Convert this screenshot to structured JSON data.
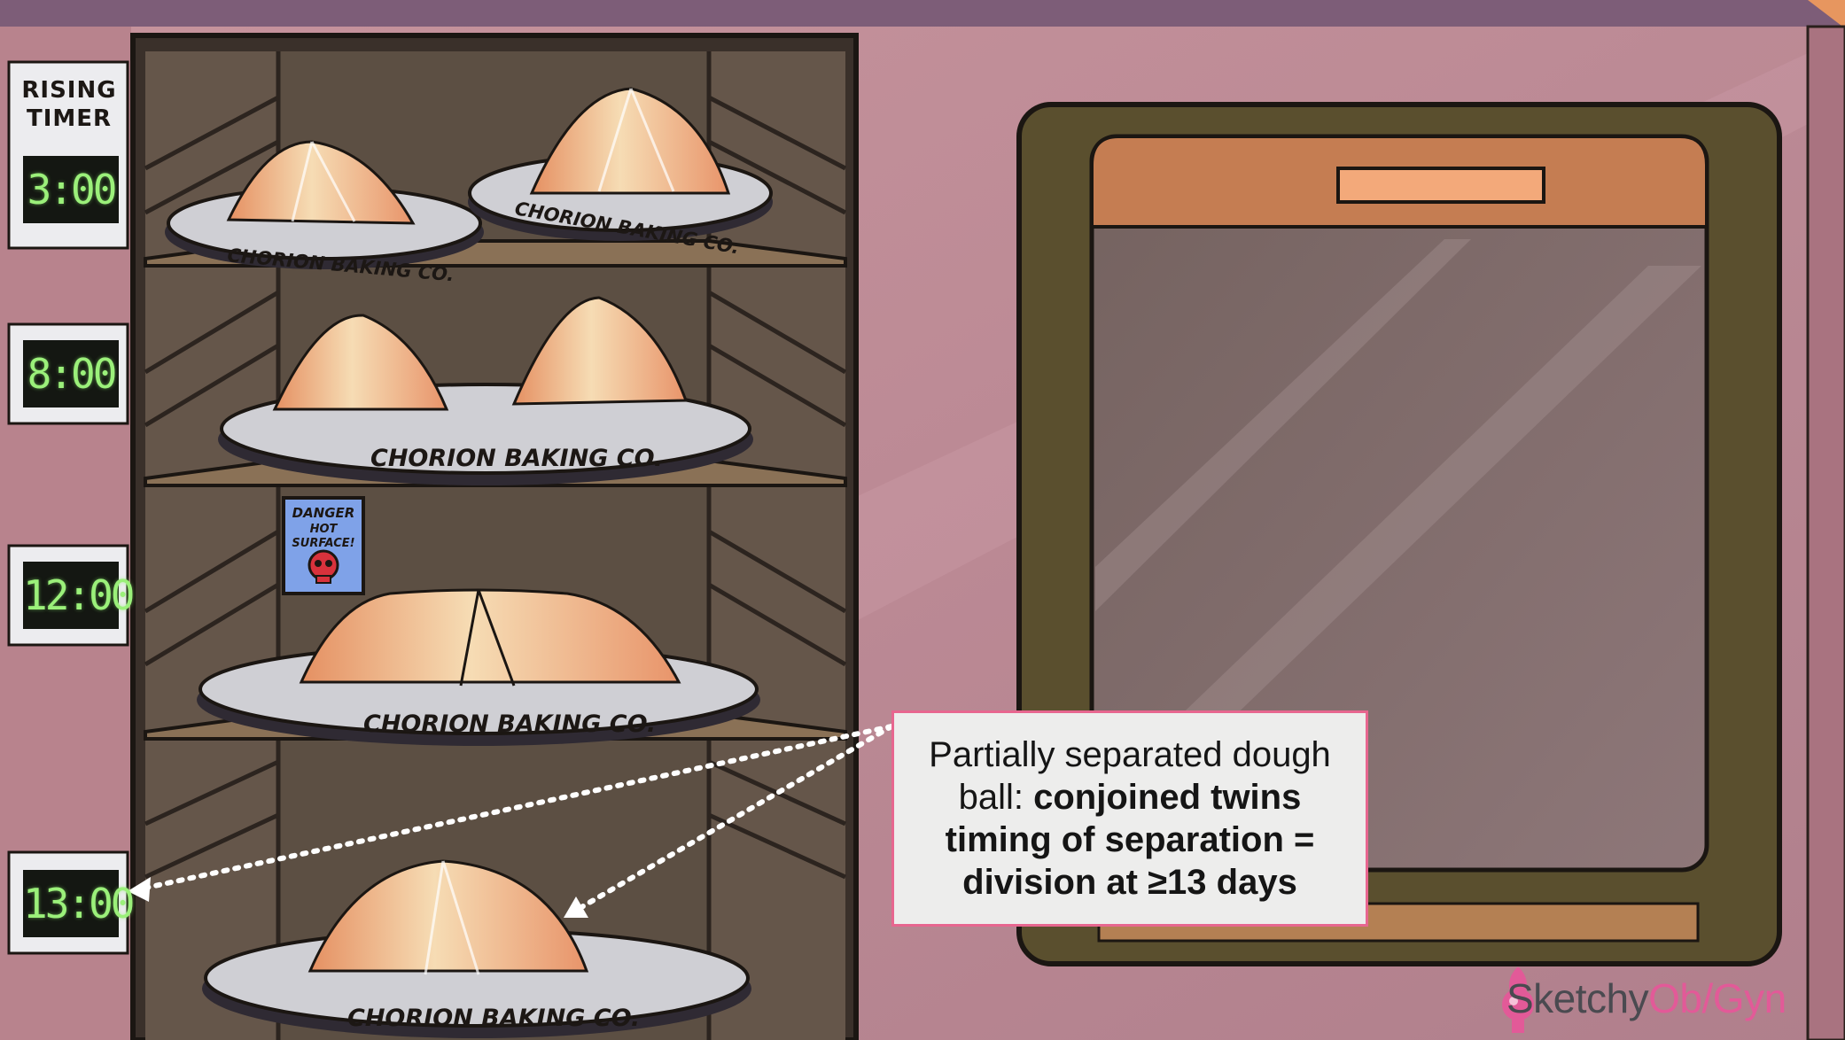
{
  "timer": {
    "title_line1": "RISING",
    "title_line2": "TIMER",
    "readings": [
      "3:00",
      "8:00",
      "12:00",
      "13:00"
    ]
  },
  "plates": {
    "label": "CHORION BAKING CO."
  },
  "warning_sign": {
    "line1": "DANGER",
    "line2": "HOT",
    "line3": "SURFACE!"
  },
  "callout": {
    "text_plain": "Partially separated dough ball: ",
    "text_bold_1": "conjoined twins",
    "text_bold_2": "timing of separation =",
    "text_bold_3": "division at ≥13 days"
  },
  "brand": {
    "name_plain": "Sketchy",
    "name_accent": "Ob/Gyn"
  },
  "colors": {
    "wall": "#b98893",
    "cabinet": "#5c4f43",
    "lcd_text": "#9bf07a",
    "callout_border": "#e7668f",
    "oven_panel": "#c57d52",
    "brand_accent": "#e25a98"
  }
}
